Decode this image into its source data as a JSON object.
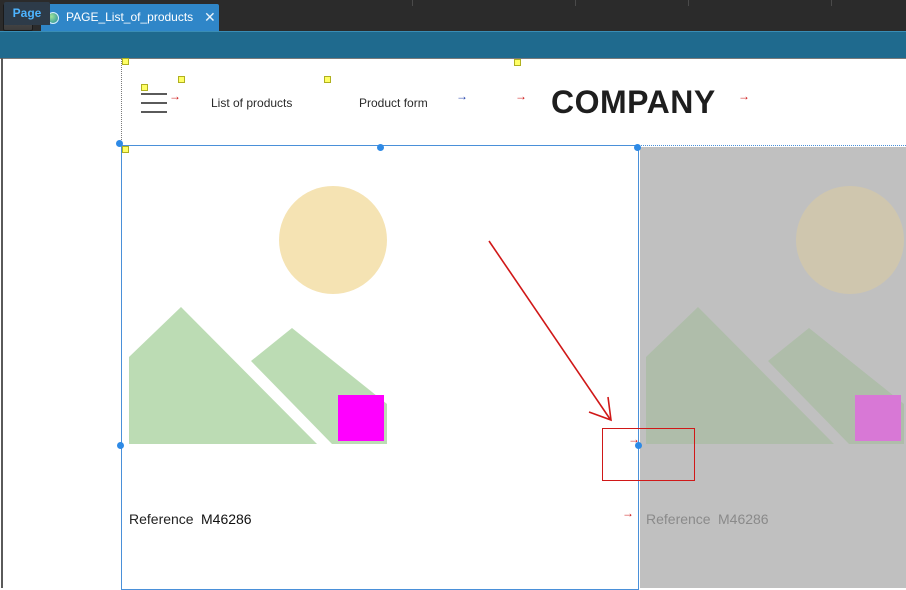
{
  "app": {
    "logo_letter": "P"
  },
  "tabs": [
    {
      "label": "PAGE_List_of_products",
      "close": "✕",
      "icon": "globe-icon"
    }
  ],
  "toolbar": {
    "page_tab_label": "Page"
  },
  "page_header": {
    "nav_items": [
      "List of products",
      "Product form"
    ],
    "brand": "COMPANY"
  },
  "cards": [
    {
      "reference_label": "Reference",
      "reference_value": "M46286",
      "selected": true,
      "colors": {
        "sun": "#f5e3b3",
        "mountain": "#bcdcb4",
        "square": "#ff00ff"
      }
    },
    {
      "reference_label": "Reference",
      "reference_value": "M46286",
      "selected": false,
      "colors": {
        "sun": "#cfc6ae",
        "mountain": "#afbdaa",
        "square": "#d878d6"
      }
    }
  ],
  "colors": {
    "titlebar": "#2b2b2b",
    "tab_active": "#2f86c8",
    "toolbar": "#1f6a8e",
    "selection": "#2e8ae6",
    "annotation": "#d01818",
    "card_inactive_bg": "#c0c0c0"
  },
  "icons": {
    "menu": "hamburger-icon",
    "link_arrow": "→"
  }
}
